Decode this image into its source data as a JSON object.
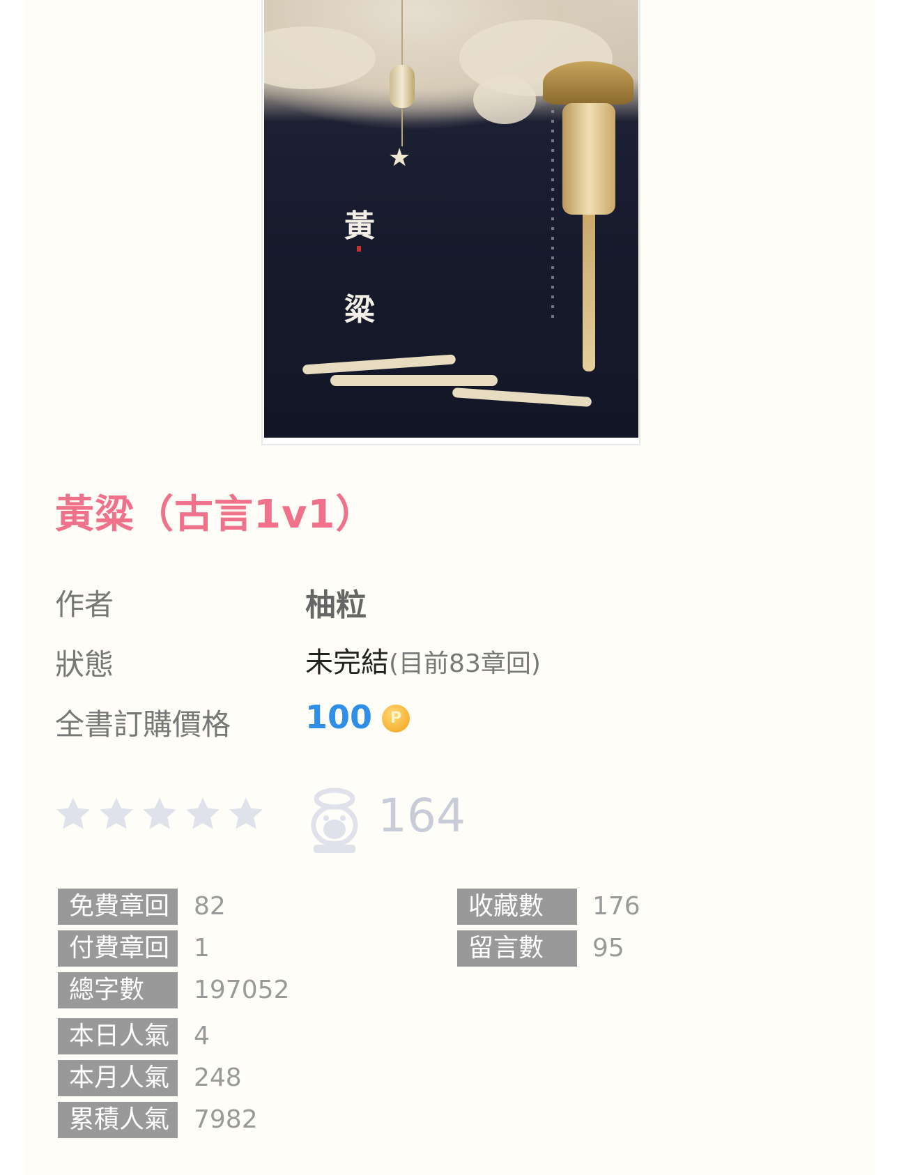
{
  "book": {
    "title": "黃粱（古言1v1）",
    "cover_text": [
      "黃",
      "粱"
    ]
  },
  "info": {
    "author_label": "作者",
    "author": "柚粒",
    "status_label": "狀態",
    "status": "未完結",
    "status_detail": "(目前83章回)",
    "price_label": "全書訂購價格",
    "price": "100",
    "coin_symbol": "P"
  },
  "rating": {
    "stars": 0,
    "max_stars": 5,
    "vote_count": "164"
  },
  "stats": {
    "left": [
      {
        "label": "免費章回",
        "value": "82"
      },
      {
        "label": "付費章回",
        "value": "1"
      },
      {
        "label": "總字數",
        "value": "197052"
      },
      {
        "label": "本日人氣",
        "value": "4"
      },
      {
        "label": "本月人氣",
        "value": "248"
      },
      {
        "label": "累積人氣",
        "value": "7982"
      }
    ],
    "right": [
      {
        "label": "收藏數",
        "value": "176"
      },
      {
        "label": "留言數",
        "value": "95"
      }
    ]
  },
  "colors": {
    "title": "#f0718a",
    "price": "#2f8ee8",
    "tag_bg": "#999999",
    "star_empty": "#dfe2ea"
  }
}
